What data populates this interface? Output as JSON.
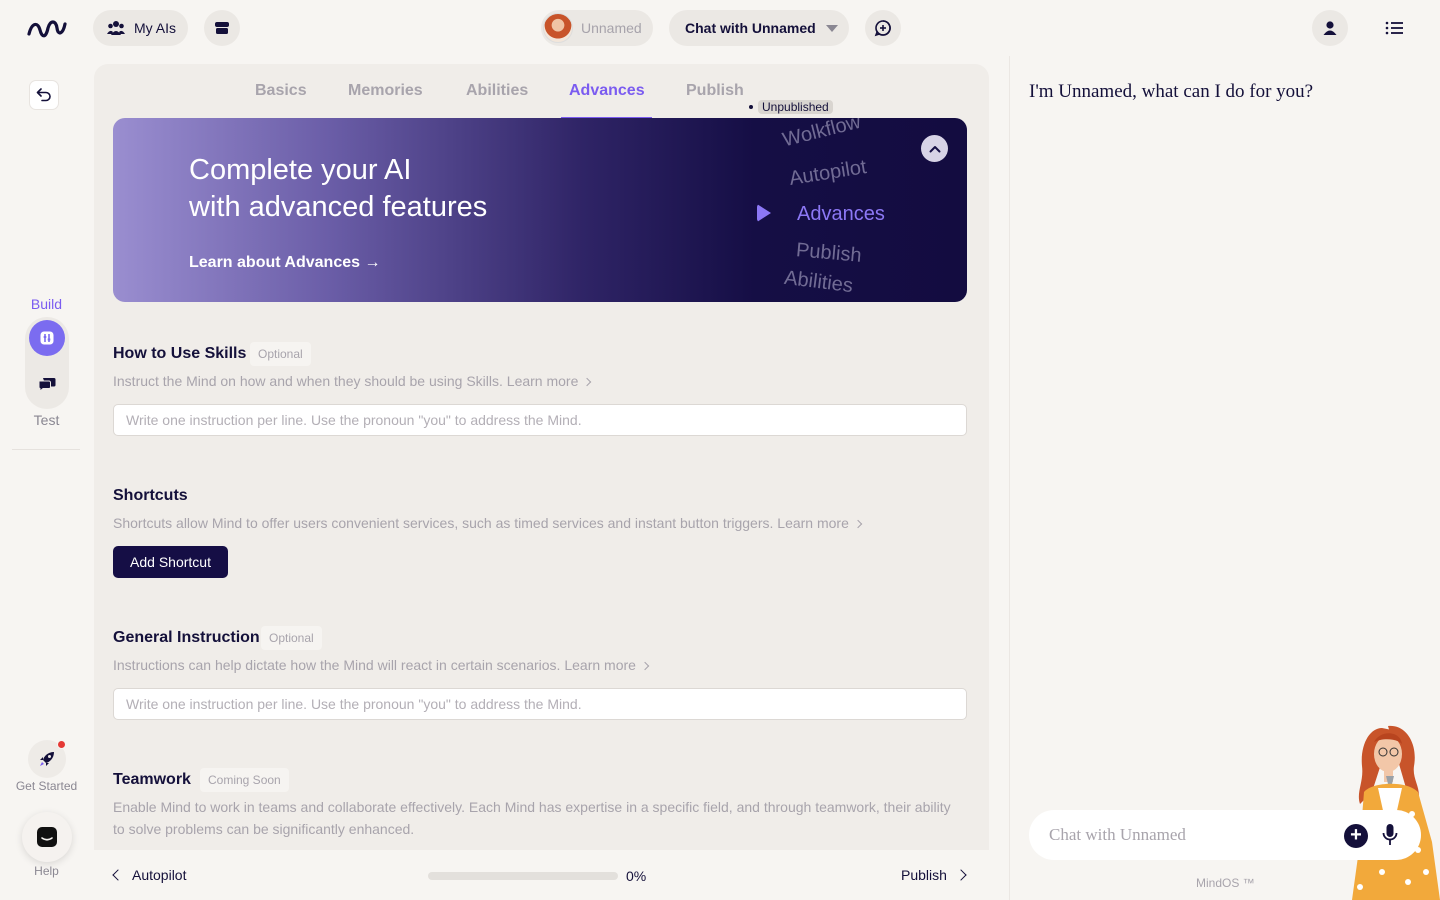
{
  "topbar": {
    "my_ais_label": "My AIs",
    "mind_name": "Unnamed",
    "chat_with_label": "Chat with Unnamed"
  },
  "rail": {
    "build_label": "Build",
    "test_label": "Test",
    "get_started_label": "Get Started",
    "help_label": "Help"
  },
  "tabs": [
    {
      "label": "Basics",
      "active": false
    },
    {
      "label": "Memories",
      "active": false
    },
    {
      "label": "Abilities",
      "active": false
    },
    {
      "label": "Advances",
      "active": true
    },
    {
      "label": "Publish",
      "active": false
    }
  ],
  "publish_status": "Unpublished",
  "banner": {
    "title_line1": "Complete your AI",
    "title_line2": "with advanced features",
    "link_label": "Learn about Advances →",
    "wheel_items": [
      "Wolkflow",
      "Autopilot",
      "Advances",
      "Publish",
      "Abilities"
    ]
  },
  "sections": {
    "skills": {
      "title": "How to Use Skills",
      "tag": "Optional",
      "description": "Instruct the Mind on how and when they should be using Skills. Learn more",
      "placeholder": "Write one instruction per line. Use the pronoun \"you\" to address the Mind."
    },
    "shortcuts": {
      "title": "Shortcuts",
      "description": "Shortcuts allow Mind to offer users convenient services, such as timed services and instant button triggers. Learn more",
      "button_label": "Add Shortcut"
    },
    "general": {
      "title": "General Instruction",
      "tag": "Optional",
      "description": "Instructions can help dictate how the Mind will react in certain scenarios. Learn more",
      "placeholder": "Write one instruction per line. Use the pronoun \"you\" to address the Mind."
    },
    "teamwork": {
      "title": "Teamwork",
      "tag": "Coming Soon",
      "description_line1": "Enable Mind to work in teams and collaborate effectively. Each Mind has expertise in a specific field, and through teamwork, their ability",
      "description_line2": "to solve problems can be significantly enhanced."
    }
  },
  "footer": {
    "back_label": "Autopilot",
    "next_label": "Publish",
    "progress_percent": 0,
    "progress_label": "0%"
  },
  "chat": {
    "greeting": "I'm Unnamed, what can I do for you?",
    "input_placeholder": "Chat with Unnamed",
    "brand": "MindOS ™"
  },
  "colors": {
    "accent": "#7b5cf0",
    "navy": "#150e45",
    "background": "#f7f5f2"
  }
}
